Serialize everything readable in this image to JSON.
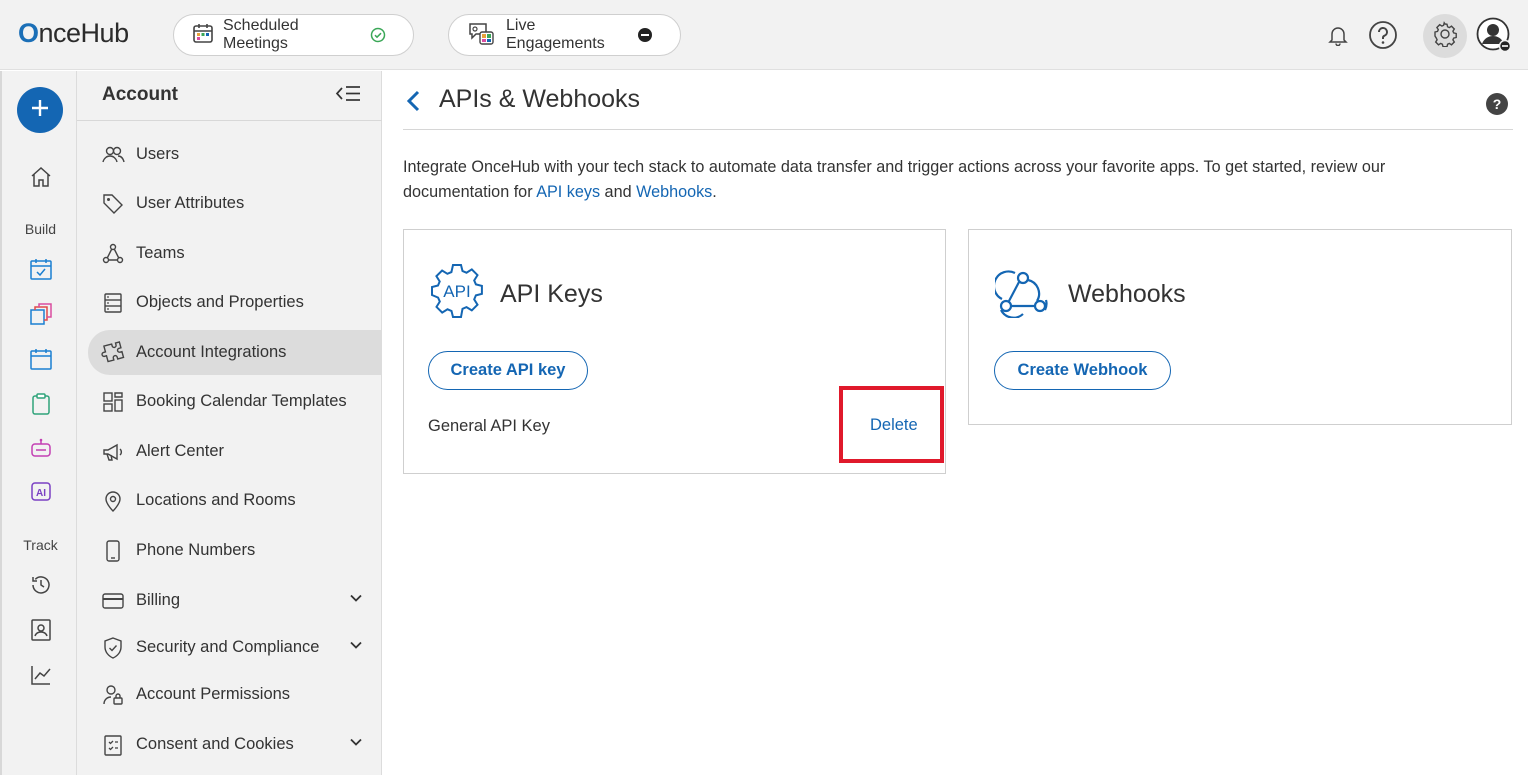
{
  "topbar": {
    "logo_text_prefix": "O",
    "logo_text_rest": "nceHub",
    "scheduled_meetings_label": "Scheduled Meetings",
    "live_engagements_label": "Live Engagements",
    "icons": [
      "calendar-icon",
      "check-circle-icon",
      "live-chat-icon",
      "minus-circle-icon",
      "bell-icon",
      "help-icon",
      "gear-icon",
      "profile-avatar-icon"
    ]
  },
  "rail": {
    "create_icon": "plus-icon",
    "home_icon": "home-icon",
    "build_label": "Build",
    "track_label": "Track",
    "build_icons": [
      "booking-calendar-icon",
      "pages-icon",
      "event-types-icon",
      "forms-icon",
      "chatbot-icon",
      "ai-agent-icon"
    ],
    "track_icons": [
      "history-icon",
      "contacts-icon",
      "analytics-icon"
    ],
    "ai_badge": "AI"
  },
  "sidebar": {
    "title": "Account",
    "items": [
      {
        "label": "Users",
        "icon": "users-icon"
      },
      {
        "label": "User Attributes",
        "icon": "tag-icon"
      },
      {
        "label": "Teams",
        "icon": "teams-icon"
      },
      {
        "label": "Objects and Properties",
        "icon": "objects-icon"
      },
      {
        "label": "Account Integrations",
        "icon": "puzzle-icon",
        "active": true
      },
      {
        "label": "Booking Calendar Templates",
        "icon": "template-icon"
      },
      {
        "label": "Alert Center",
        "icon": "megaphone-icon"
      },
      {
        "label": "Locations and Rooms",
        "icon": "location-pin-icon"
      },
      {
        "label": "Phone Numbers",
        "icon": "phone-icon"
      },
      {
        "label": "Billing",
        "icon": "credit-card-icon",
        "expandable": true
      },
      {
        "label": "Security and Compliance",
        "icon": "shield-icon",
        "expandable": true
      },
      {
        "label": "Account Permissions",
        "icon": "user-lock-icon"
      },
      {
        "label": "Consent and Cookies",
        "icon": "clipboard-check-icon",
        "expandable": true
      }
    ]
  },
  "main": {
    "title": "APIs & Webhooks",
    "help": "?",
    "intro_text_1": "Integrate OnceHub with your tech stack to automate data transfer and trigger actions across your favorite apps. To get started, review our documentation for ",
    "intro_link_api": "API keys",
    "intro_text_2": " and ",
    "intro_link_webhooks": "Webhooks",
    "intro_text_3": ".",
    "api_card": {
      "icon_text": "API",
      "title": "API Keys",
      "button": "Create API key",
      "key_name": "General API Key",
      "delete": "Delete"
    },
    "webhooks_card": {
      "title": "Webhooks",
      "button": "Create Webhook"
    }
  },
  "colors": {
    "accent": "#1466b3",
    "highlight": "#e0192b",
    "sidebar_bg": "#f2f2f2"
  }
}
